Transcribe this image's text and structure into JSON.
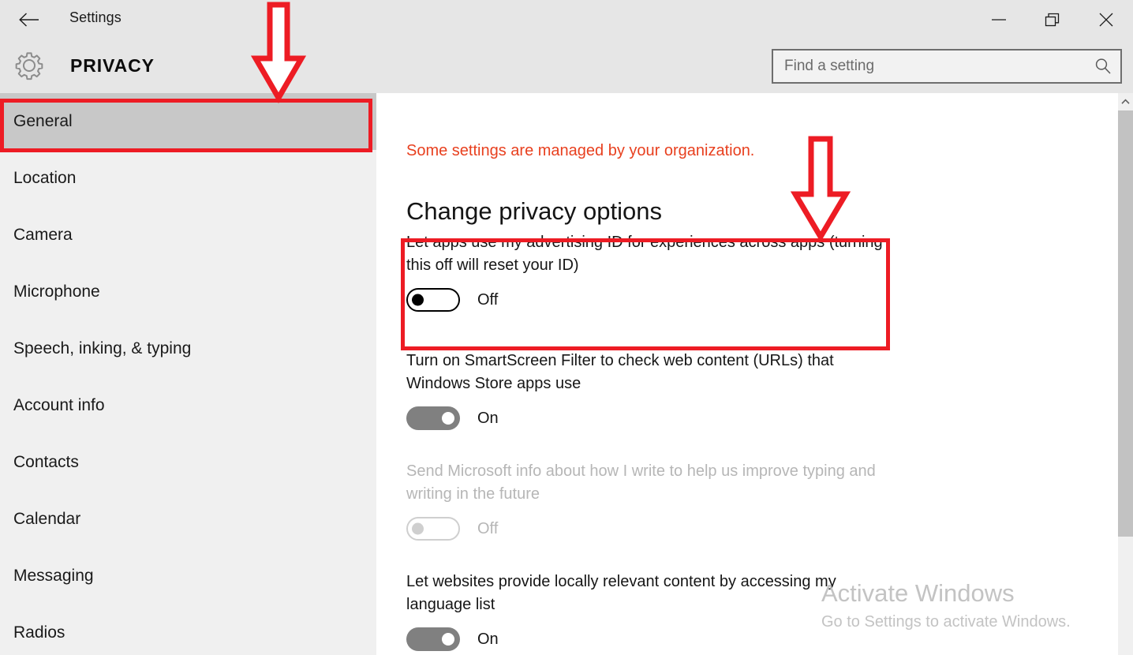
{
  "window": {
    "app_title": "Settings",
    "back_icon": "back-arrow-icon",
    "minimize_label": "—",
    "restore_label": "restore-icon",
    "close_label": "✕"
  },
  "header": {
    "icon": "gear-icon",
    "title": "PRIVACY"
  },
  "search": {
    "placeholder": "Find a setting",
    "value": "",
    "icon": "search-icon"
  },
  "sidebar": {
    "items": [
      {
        "label": "General",
        "selected": true
      },
      {
        "label": "Location",
        "selected": false
      },
      {
        "label": "Camera",
        "selected": false
      },
      {
        "label": "Microphone",
        "selected": false
      },
      {
        "label": "Speech, inking, & typing",
        "selected": false
      },
      {
        "label": "Account info",
        "selected": false
      },
      {
        "label": "Contacts",
        "selected": false
      },
      {
        "label": "Calendar",
        "selected": false
      },
      {
        "label": "Messaging",
        "selected": false
      },
      {
        "label": "Radios",
        "selected": false
      }
    ]
  },
  "main": {
    "org_notice": "Some settings are managed by your organization.",
    "section_heading": "Change privacy options",
    "settings": [
      {
        "label": "Let apps use my advertising ID for experiences across apps (turning this off will reset your ID)",
        "state": "Off",
        "on": false,
        "disabled": false,
        "highlighted": true
      },
      {
        "label": "Turn on SmartScreen Filter to check web content (URLs) that Windows Store apps use",
        "state": "On",
        "on": true,
        "disabled": false,
        "highlighted": false
      },
      {
        "label": "Send Microsoft info about how I write to help us improve typing and writing in the future",
        "state": "Off",
        "on": false,
        "disabled": true,
        "highlighted": false
      },
      {
        "label": "Let websites provide locally relevant content by accessing my language list",
        "state": "On",
        "on": true,
        "disabled": false,
        "highlighted": false
      }
    ]
  },
  "watermark": {
    "title": "Activate Windows",
    "subtitle": "Go to Settings to activate Windows."
  },
  "scrollbar": {
    "up_arrow_icon": "chevron-up-icon"
  },
  "annotations": {
    "accent_color": "#ed1c24",
    "arrow_top_target": "General sidebar item",
    "arrow_right_target": "advertising ID setting",
    "box_sidebar_target": "General",
    "box_setting_target": "Let apps use my advertising ID for experiences across apps"
  },
  "colors": {
    "titlebar_bg": "#e6e6e6",
    "sidebar_bg": "#f0f0f0",
    "sidebar_selected_bg": "#c8c8c8",
    "content_bg": "#ffffff",
    "notice_red": "#e8401f",
    "annotation_red": "#ed1c24",
    "toggle_on": "#808080",
    "watermark_gray": "#c3c3c3"
  }
}
